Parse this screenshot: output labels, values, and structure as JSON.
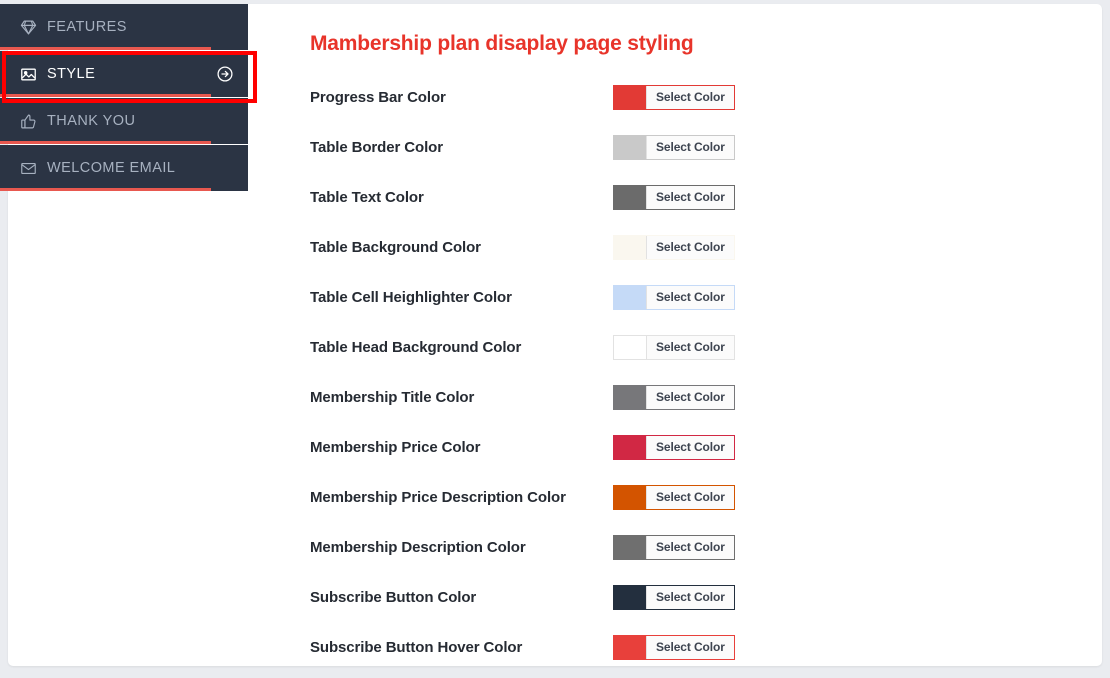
{
  "page": {
    "background_color": "#eaecf0",
    "card_background": "#ffffff"
  },
  "sidebar": {
    "background_color": "#2b3444",
    "progress_color": "#e8584f",
    "items": [
      {
        "label": "FEATURES",
        "icon": "gem-icon",
        "active": false,
        "progress": 85,
        "has_arrow": false
      },
      {
        "label": "STYLE",
        "icon": "image-icon",
        "active": true,
        "progress": 85,
        "has_arrow": true
      },
      {
        "label": "THANK YOU",
        "icon": "thumbs-up-icon",
        "active": false,
        "progress": 85,
        "has_arrow": false
      },
      {
        "label": "WELCOME EMAIL",
        "icon": "envelope-icon",
        "active": false,
        "progress": 85,
        "has_arrow": false
      }
    ],
    "highlight": {
      "target": "STYLE",
      "color": "#ff0000"
    }
  },
  "main": {
    "title": "Mambership plan disaplay page styling",
    "title_color": "#e8342a",
    "select_color_label": "Select Color",
    "fields": [
      {
        "label": "Progress Bar Color",
        "color": "#e23a35"
      },
      {
        "label": "Table Border Color",
        "color": "#c9c9c9"
      },
      {
        "label": "Table Text Color",
        "color": "#6b6b6b"
      },
      {
        "label": "Table Background Color",
        "color": "#faf7ef"
      },
      {
        "label": "Table Cell Heighlighter Color",
        "color": "#c5daf7"
      },
      {
        "label": "Table Head Background Color",
        "color": "#ffffff"
      },
      {
        "label": "Membership Title Color",
        "color": "#77777a"
      },
      {
        "label": "Membership Price Color",
        "color": "#d12844"
      },
      {
        "label": "Membership Price Description Color",
        "color": "#d35400"
      },
      {
        "label": "Membership Description Color",
        "color": "#6f6f6f"
      },
      {
        "label": "Subscribe Button Color",
        "color": "#232f3e"
      },
      {
        "label": "Subscribe Button Hover Color",
        "color": "#e8403b"
      }
    ]
  }
}
